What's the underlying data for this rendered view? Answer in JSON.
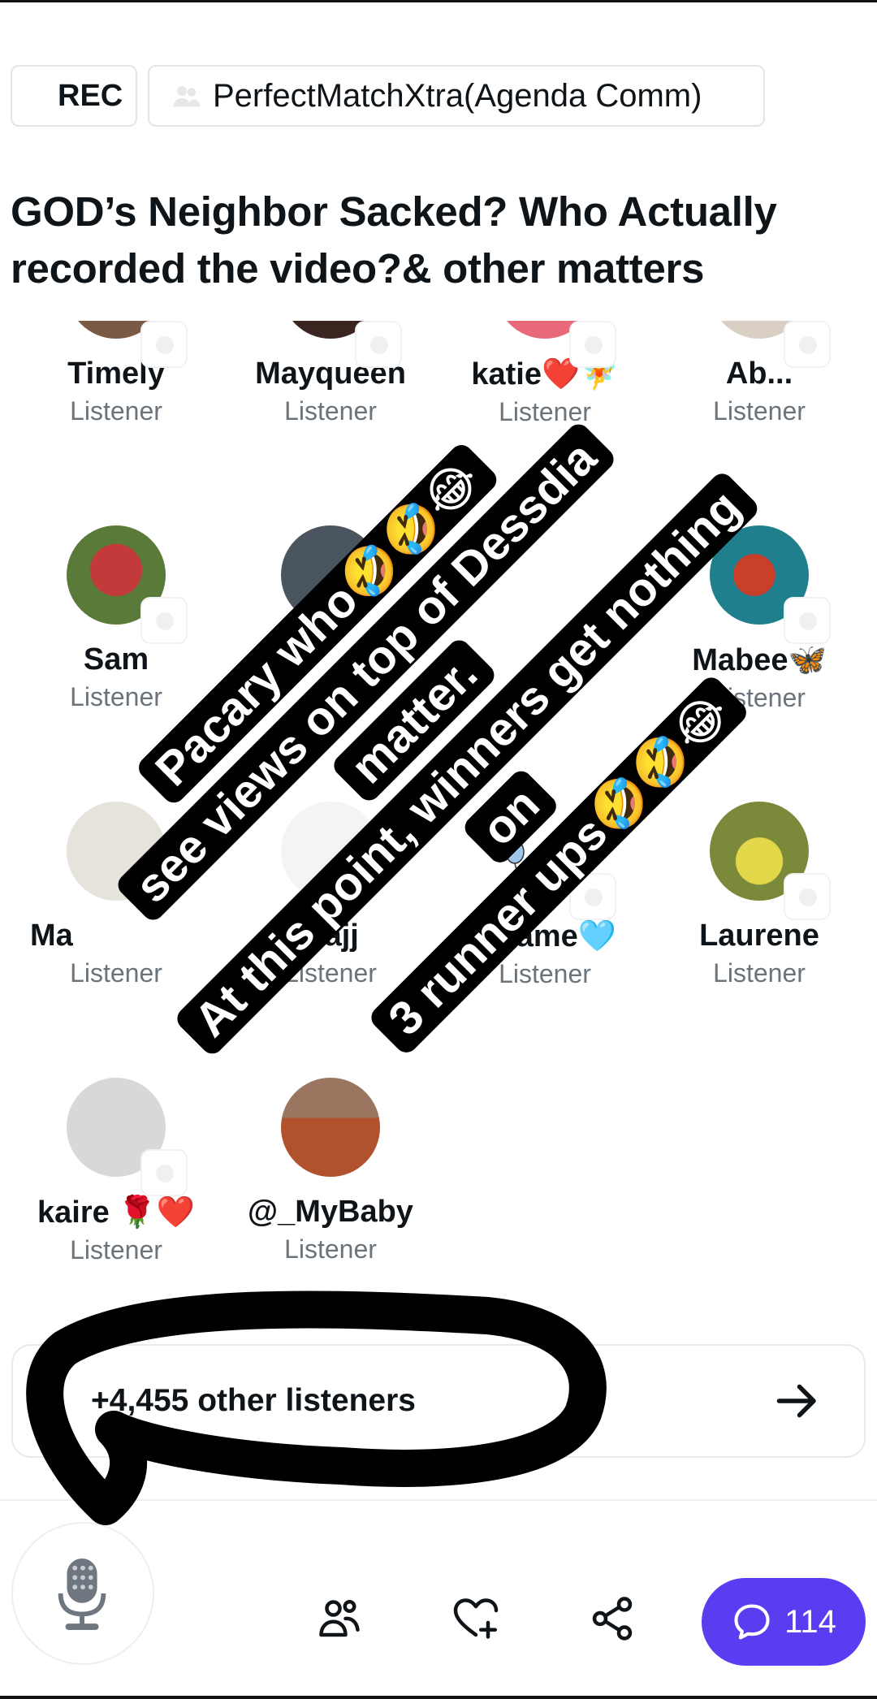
{
  "header": {
    "rec_label": "REC",
    "space_name": "PerfectMatchXtra(Agenda Comm)",
    "title": "GOD’s Neighbor Sacked? Who Actually recorded the video?& other matters"
  },
  "listeners": [
    {
      "name": "Timely",
      "role": "Listener",
      "avatar_color": "#7a5a45"
    },
    {
      "name": "Mayqueen",
      "role": "Listener",
      "avatar_color": "#3a2520"
    },
    {
      "name": "katie❤️🧚",
      "role": "Listener",
      "avatar_color": "#e86a7a"
    },
    {
      "name": "Ab...",
      "role": "Listener",
      "avatar_color": "#d9cfc4"
    },
    {
      "name": "Sam",
      "role": "Listener",
      "avatar_color": "#b33a3a"
    },
    {
      "name": "",
      "role": "",
      "avatar_color": "#4a5560"
    },
    {
      "name": "",
      "role": "",
      "avatar_color": "#ffffff"
    },
    {
      "name": "Mabee🦋",
      "role": "Listener",
      "avatar_color": "#1f7f8c"
    },
    {
      "name": "Ma",
      "role": "Listener",
      "avatar_color": "#e6e2dc"
    },
    {
      "name": "Hajj",
      "role": "Listener",
      "avatar_color": "#ffffff"
    },
    {
      "name": "Maame🩵",
      "role": "Listener",
      "avatar_color": "#ffffff"
    },
    {
      "name": "Laurene",
      "role": "Listener",
      "avatar_color": "#7b8a3a"
    },
    {
      "name": "kaire 🌹❤️",
      "role": "Listener",
      "avatar_color": "#d8d8d8"
    },
    {
      "name": "@_MyBaby",
      "role": "Listener",
      "avatar_color": "#b0522e"
    }
  ],
  "others": {
    "label": "+4,455 other listeners"
  },
  "bottom": {
    "reply_count": "114"
  },
  "overlay": {
    "lines": [
      "Pacary who🤣🤣😂",
      "see views on top of Dessdia matter.",
      "At this point, winners get nothing on",
      "3 runner ups🤣🤣😂"
    ]
  },
  "colors": {
    "accent": "#5b3cf0",
    "secondary_text": "#6b737b",
    "border": "#e1e5e8"
  }
}
